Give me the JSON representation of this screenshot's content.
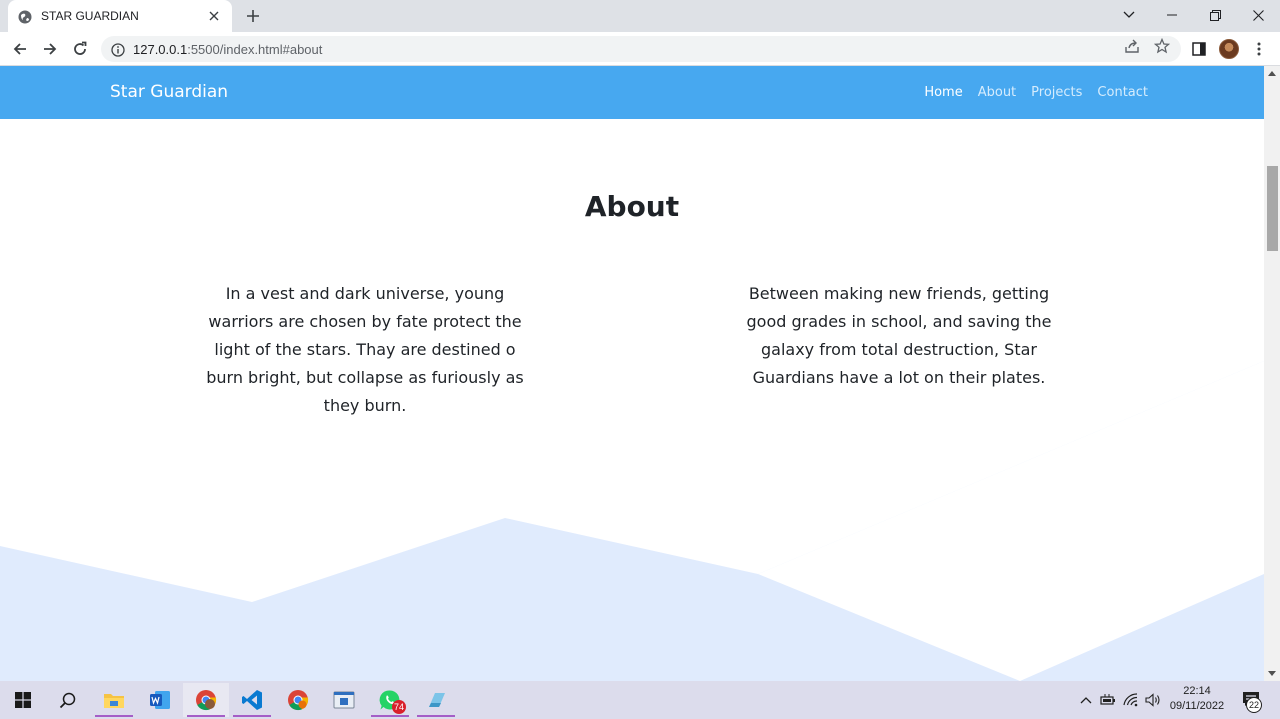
{
  "browser": {
    "tab_title": "STAR GUARDIAN",
    "url_host": "127.0.0.1",
    "url_rest": ":5500/index.html#about",
    "icons": [
      "globe-icon",
      "close-icon",
      "plus-icon",
      "back-icon",
      "forward-icon",
      "reload-icon",
      "info-icon",
      "share-icon",
      "star-icon",
      "side-panel-icon",
      "avatar",
      "more-icon"
    ]
  },
  "site": {
    "brand": "Star Guardian",
    "nav": [
      {
        "label": "Home",
        "active": true
      },
      {
        "label": "About",
        "active": false
      },
      {
        "label": "Projects",
        "active": false
      },
      {
        "label": "Contact",
        "active": false
      }
    ],
    "about_title": "About",
    "col_left": "In a vest and dark universe, young warriors are chosen by fate protect the light of the stars. Thay are destined o burn bright, but collapse as furiously as they burn.",
    "col_right": "Between making new friends, getting good grades in school, and saving the galaxy from total destruction, Star Guardians have a lot on their plates.",
    "nav_color": "#47a8f0",
    "wave_color": "#e0ebfd"
  },
  "taskbar": {
    "apps": [
      "windows-start-icon",
      "search-icon",
      "file-explorer-icon",
      "word-icon",
      "chrome-icon",
      "vscode-icon",
      "chrome-icon",
      "app-icon",
      "whatsapp-icon",
      "app-icon"
    ],
    "whatsapp_badge": "74",
    "time": "22:14",
    "date": "09/11/2022",
    "notifications": "22"
  }
}
